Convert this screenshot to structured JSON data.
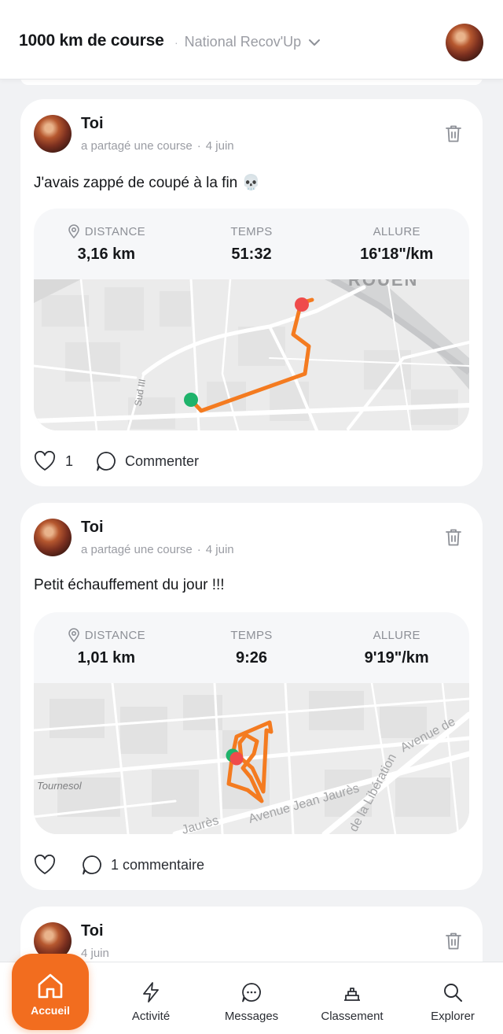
{
  "header": {
    "title": "1000 km de course",
    "separator": "·",
    "group": "National Recov'Up"
  },
  "posts": [
    {
      "author": "Toi",
      "action": "a partagé une course",
      "separator": "·",
      "date": "4 juin",
      "text": "J'avais zappé de coupé à la fin 💀",
      "stats": [
        {
          "label": "DISTANCE",
          "value": "3,16 km"
        },
        {
          "label": "TEMPS",
          "value": "51:32"
        },
        {
          "label": "ALLURE",
          "value": "16'18\"/km"
        }
      ],
      "map_labels": [
        "ROUEN",
        "Sud III"
      ],
      "likes": "1",
      "comment_label": "Commenter"
    },
    {
      "author": "Toi",
      "action": "a partagé une course",
      "separator": "·",
      "date": "4 juin",
      "text": "Petit échauffement du jour !!!",
      "stats": [
        {
          "label": "DISTANCE",
          "value": "1,01 km"
        },
        {
          "label": "TEMPS",
          "value": "9:26"
        },
        {
          "label": "ALLURE",
          "value": "9'19\"/km"
        }
      ],
      "map_labels": [
        "Tournesol",
        "Avenue Jean Jaurès",
        "Jaurès",
        "de la Libération",
        "Avenue de"
      ],
      "comment_label": "1 commentaire"
    },
    {
      "author": "Toi",
      "date": "4 juin"
    }
  ],
  "nav": [
    {
      "label": "Accueil",
      "icon": "home-icon"
    },
    {
      "label": "Activité",
      "icon": "lightning-icon"
    },
    {
      "label": "Messages",
      "icon": "chat-icon"
    },
    {
      "label": "Classement",
      "icon": "podium-icon"
    },
    {
      "label": "Explorer",
      "icon": "search-icon"
    }
  ],
  "colors": {
    "accent": "#f26d1f",
    "route": "#f47b20",
    "start": "#1fb36b",
    "end": "#ef4b4b"
  }
}
